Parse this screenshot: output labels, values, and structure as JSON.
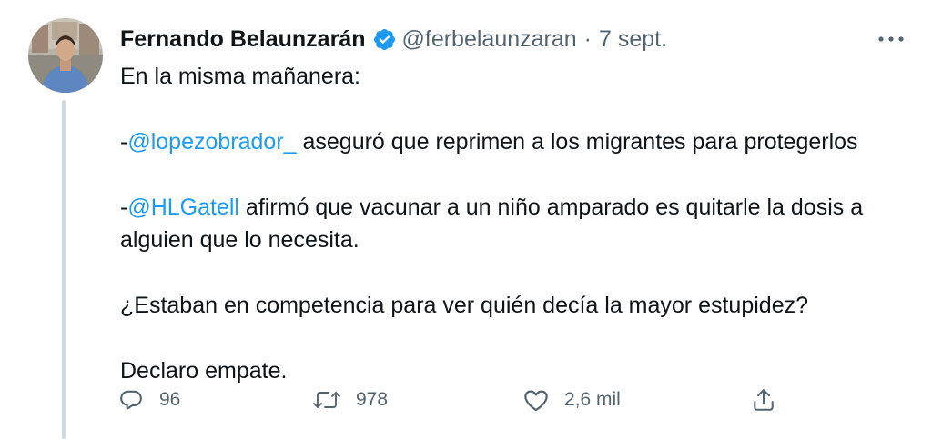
{
  "author": {
    "name": "Fernando Belaunzarán",
    "handle": "@ferbelaunzaran",
    "separator": "·",
    "date": "7 sept."
  },
  "tweet": {
    "line1": "En la misma mañanera:",
    "p2_prefix": "-",
    "p2_mention": "@lopezobrador_",
    "p2_text": " aseguró que reprimen a los migrantes para protegerlos",
    "p3_prefix": "-",
    "p3_mention": "@HLGatell",
    "p3_text": " afirmó que vacunar a un niño amparado es quitarle la dosis a alguien que lo necesita.",
    "p4": "¿Estaban en competencia para ver quién decía la mayor estupidez?",
    "p5": "Declaro empate."
  },
  "actions": {
    "replies": "96",
    "retweets": "978",
    "likes": "2,6 mil"
  },
  "icons": {
    "more": "more-horizontal-icon",
    "verified": "verified-badge-icon",
    "reply": "reply-icon",
    "retweet": "retweet-icon",
    "like": "heart-icon",
    "share": "share-icon"
  },
  "colors": {
    "text": "#0f1419",
    "secondary": "#536471",
    "link": "#1d9bf0",
    "verified": "#1d9bf0",
    "thread_line": "#cfd9de"
  }
}
